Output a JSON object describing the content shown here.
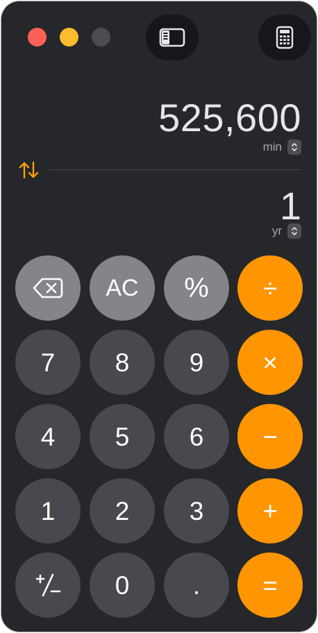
{
  "display": {
    "primary_value": "525,600",
    "primary_unit": "min",
    "secondary_value": "1",
    "secondary_unit": "yr"
  },
  "keys": {
    "backspace_icon": "delete-left-icon",
    "clear": "AC",
    "percent": "%",
    "divide": "÷",
    "seven": "7",
    "eight": "8",
    "nine": "9",
    "multiply": "×",
    "four": "4",
    "five": "5",
    "six": "6",
    "subtract": "−",
    "one": "1",
    "two": "2",
    "three": "3",
    "add": "+",
    "sign_icon": "plus-minus-icon",
    "zero": "0",
    "decimal": ".",
    "equals": "="
  },
  "colors": {
    "window_background": "#25272b",
    "number_key": "#47494e",
    "function_key": "#838589",
    "operator_key": "#ff9500",
    "swap_icon": "#ff9f0a",
    "close": "#fe5f57",
    "minimize": "#febc2e",
    "zoom_inactive": "#4a4c50"
  },
  "toolbar": {
    "sidebar_icon": "sidebar-icon",
    "mode_icon": "calculator-icon"
  }
}
